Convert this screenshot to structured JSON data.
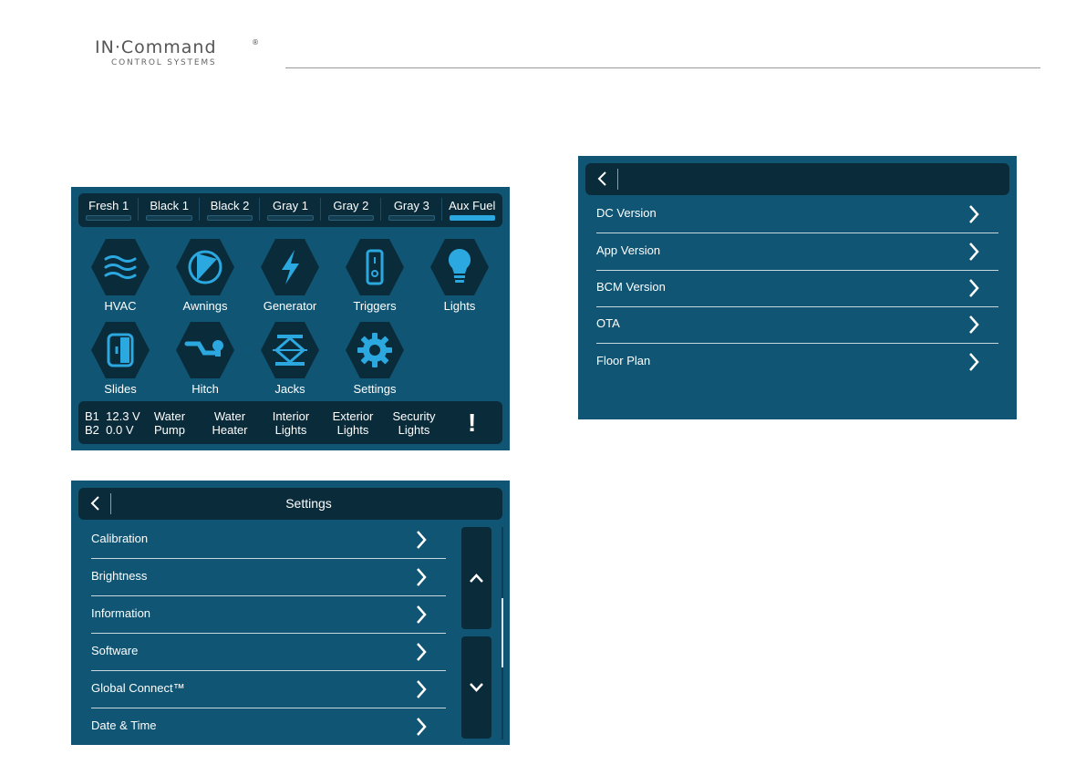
{
  "header": {
    "logo_main": "IN·Command",
    "logo_reg": "®",
    "logo_sub": "CONTROL SYSTEMS"
  },
  "colors": {
    "screen_bg": "#105573",
    "bar_bg": "#0a2b3a",
    "accent": "#2aa8df",
    "icon_hex": "#0a2b3a"
  },
  "home": {
    "tanks": [
      {
        "label": "Fresh 1",
        "active": false
      },
      {
        "label": "Black 1",
        "active": false
      },
      {
        "label": "Black 2",
        "active": false
      },
      {
        "label": "Gray 1",
        "active": false
      },
      {
        "label": "Gray 2",
        "active": false
      },
      {
        "label": "Gray 3",
        "active": false
      },
      {
        "label": "Aux Fuel",
        "active": true
      }
    ],
    "icons": [
      {
        "label": "HVAC",
        "icon": "hvac-waves-icon"
      },
      {
        "label": "Awnings",
        "icon": "awning-icon"
      },
      {
        "label": "Generator",
        "icon": "lightning-bolt-icon"
      },
      {
        "label": "Triggers",
        "icon": "switch-icon"
      },
      {
        "label": "Lights",
        "icon": "light-bulb-icon"
      },
      {
        "label": "Slides",
        "icon": "slide-out-icon"
      },
      {
        "label": "Hitch",
        "icon": "trailer-hitch-icon"
      },
      {
        "label": "Jacks",
        "icon": "scissor-jack-icon"
      },
      {
        "label": "Settings",
        "icon": "gear-icon"
      }
    ],
    "battery": {
      "b1_label": "B1",
      "b1_value": "12.3 V",
      "b2_label": "B2",
      "b2_value": "0.0 V"
    },
    "quick_buttons": [
      {
        "line1": "Water",
        "line2": "Pump"
      },
      {
        "line1": "Water",
        "line2": "Heater"
      },
      {
        "line1": "Interior",
        "line2": "Lights"
      },
      {
        "line1": "Exterior",
        "line2": "Lights"
      },
      {
        "line1": "Security",
        "line2": "Lights"
      }
    ],
    "alert": "!"
  },
  "settings": {
    "title": "Settings",
    "items": [
      {
        "label": "Calibration"
      },
      {
        "label": "Brightness"
      },
      {
        "label": "Information"
      },
      {
        "label": "Software"
      },
      {
        "label": "Global Connect™"
      },
      {
        "label": "Date & Time"
      }
    ]
  },
  "information": {
    "title": "",
    "items": [
      {
        "label": "DC Version"
      },
      {
        "label": "App Version"
      },
      {
        "label": "BCM Version"
      },
      {
        "label": "OTA"
      },
      {
        "label": "Floor Plan"
      }
    ]
  }
}
